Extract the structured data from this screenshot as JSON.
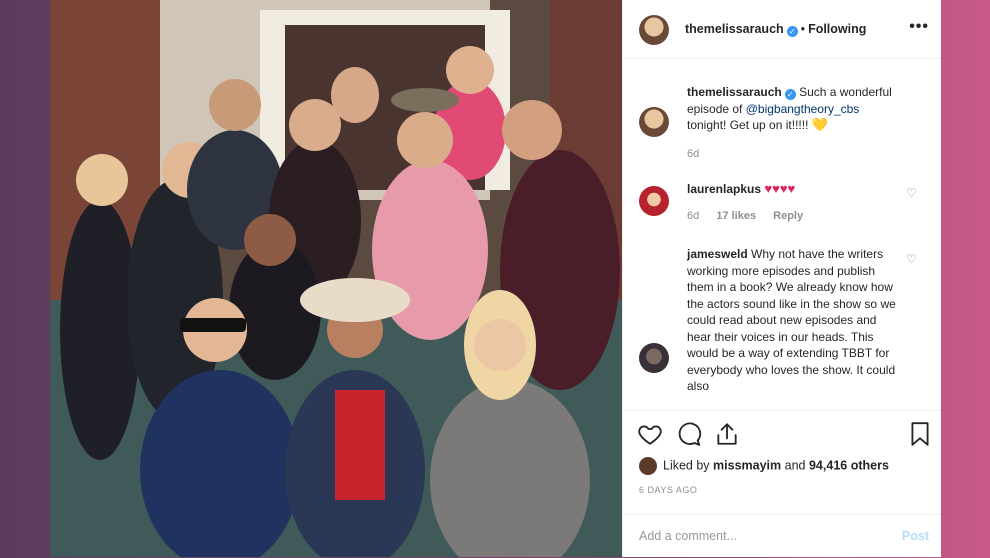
{
  "post": {
    "username": "themelissarauch",
    "verified_mark": "✓",
    "separator": "•",
    "follow_status": "Following",
    "more_label": "•••"
  },
  "caption": {
    "username": "themelissarauch",
    "text_before": "Such a wonderful episode of ",
    "mention": "@bigbangtheory_cbs",
    "text_after": " tonight! Get up on it!!!!! ",
    "emoji": "💛",
    "age": "6d"
  },
  "comments": [
    {
      "username": "laurenlapkus",
      "hearts": "♥♥♥♥",
      "age": "6d",
      "likes": "17 likes",
      "reply": "Reply"
    },
    {
      "username": "jamesweld",
      "text": "Why not have the writers working more episodes and publish them in a book? We already know how the actors sound like in the show so we could read about new episodes and hear their voices in our heads. This would be a way of extending TBBT for everybody who loves the show. It could also"
    }
  ],
  "likes": {
    "prefix": "Liked by",
    "user": "missmayim",
    "connector": "and",
    "count": "94,416 others"
  },
  "time_ago": "6 DAYS AGO",
  "comment_box": {
    "placeholder": "Add a comment...",
    "post_label": "Post"
  },
  "icons": {
    "like": "heart-outline-icon",
    "comment": "comment-bubble-icon",
    "share": "share-icon",
    "save": "bookmark-icon"
  },
  "colors": {
    "verified": "#3897f0",
    "post_disabled": "#b2dffc",
    "meta_gray": "#8e8e8e"
  }
}
